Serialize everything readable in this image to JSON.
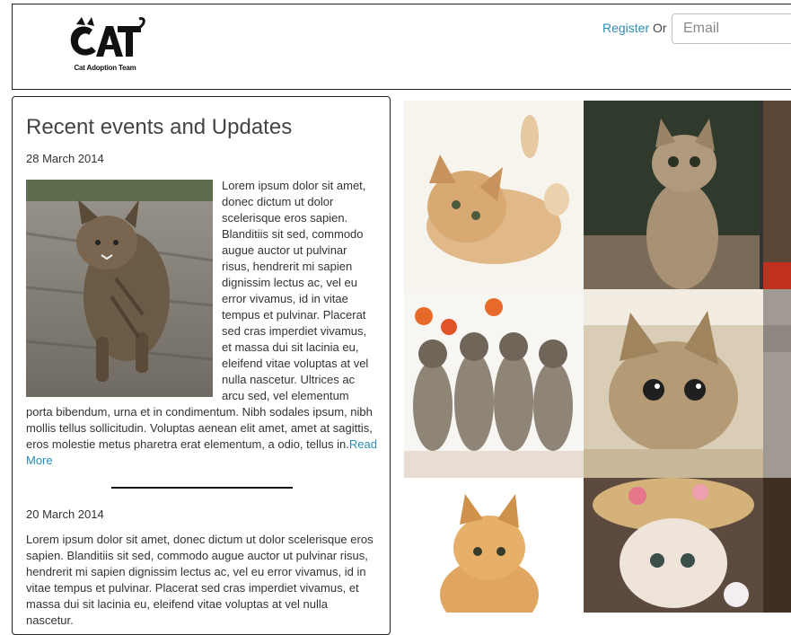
{
  "header": {
    "logo_text": "CAT",
    "logo_subtitle": "Cat Adoption Team",
    "register_label": "Register",
    "or_label": "Or",
    "email_placeholder": "Email"
  },
  "events": {
    "title": "Recent events and Updates",
    "items": [
      {
        "date": "28 March 2014",
        "body": "Lorem ipsum dolor sit amet, donec dictum ut dolor scelerisque eros sapien. Blanditiis sit sed, commodo augue auctor ut pulvinar risus, hendrerit mi sapien dignissim lectus ac, vel eu error vivamus, id in vitae tempus et pulvinar. Placerat sed cras imperdiet vivamus, et massa dui sit lacinia eu, eleifend vitae voluptas at vel nulla nascetur. Ultrices ac arcu sed, vel elementum porta bibendum, urna et in condimentum. Nibh sodales ipsum, nibh mollis tellus sollicitudin. Voluptas aenean elit amet, amet at sagittis, eros molestie metus pharetra erat elementum, a odio, tellus in.",
        "read_more": "Read More"
      },
      {
        "date": "20 March 2014",
        "body": "Lorem ipsum dolor sit amet, donec dictum ut dolor scelerisque eros sapien. Blanditiis sit sed, commodo augue auctor ut pulvinar risus, hendrerit mi sapien dignissim lectus ac, vel eu error vivamus, id in vitae tempus et pulvinar. Placerat sed cras imperdiet vivamus, et massa dui sit lacinia eu, eleifend vitae voluptas at vel nulla nascetur."
      }
    ]
  },
  "colors": {
    "link": "#2a8db3",
    "border": "#222222",
    "text": "#333333"
  }
}
